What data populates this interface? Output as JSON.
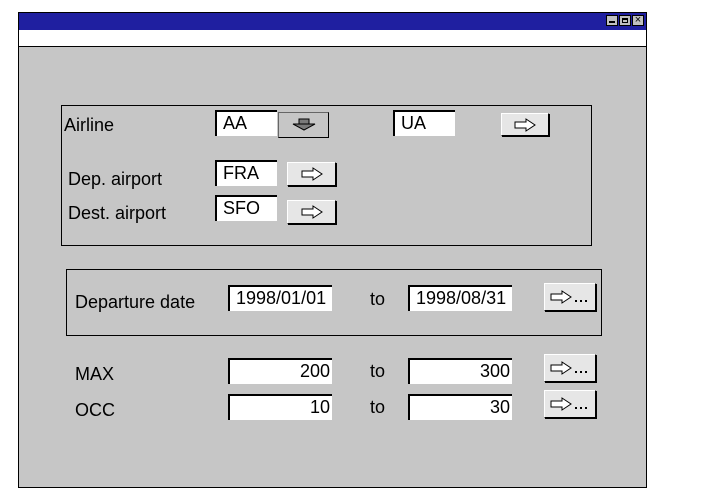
{
  "airline": {
    "label": "Airline",
    "from_value": "AA",
    "to_value": "UA",
    "dep_label": "Dep. airport",
    "dep_value": "FRA",
    "dest_label": "Dest. airport",
    "dest_value": "SFO"
  },
  "dates": {
    "label": "Departure date",
    "from_value": "1998/01/01",
    "to_label": "to",
    "to_value": "1998/08/31"
  },
  "max": {
    "label": "MAX",
    "from_value": "200",
    "to_label": "to",
    "to_value": "300"
  },
  "occ": {
    "label": "OCC",
    "from_value": "10",
    "to_label": "to",
    "to_value": "30"
  },
  "window": {
    "close_glyph": "×"
  },
  "icons": {
    "selection_arrow": "arrow-right-icon",
    "multiple_selection": "arrow-right-ellipsis-icon",
    "pressed_arrow": "arrow-down-icon"
  }
}
